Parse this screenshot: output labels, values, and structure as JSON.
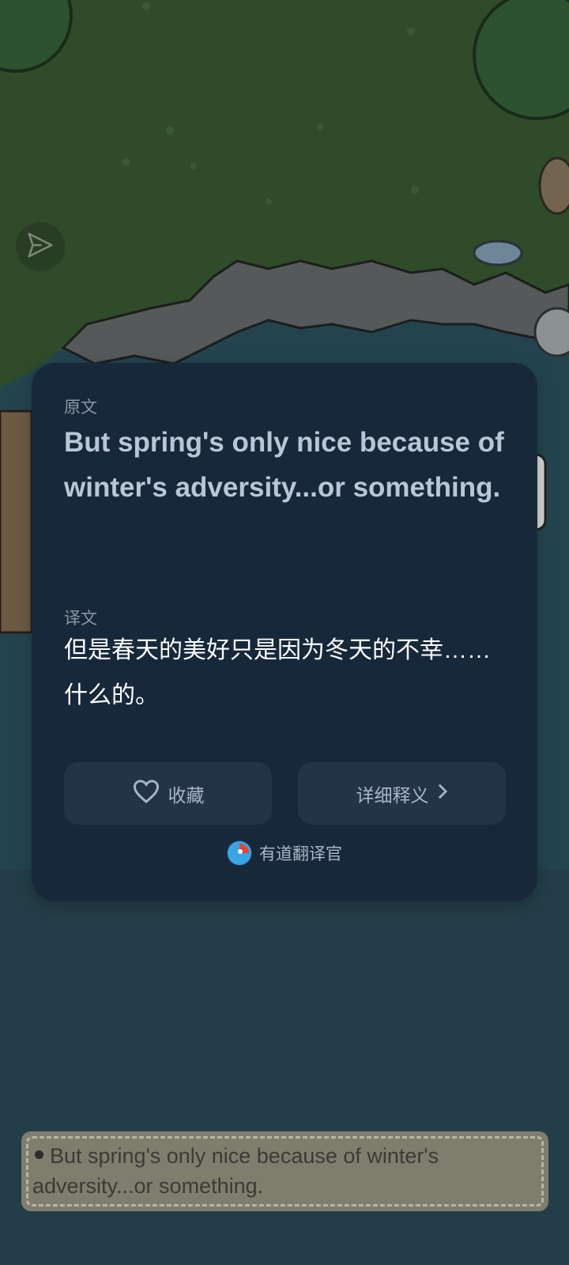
{
  "card": {
    "source_label": "原文",
    "source_text": "But spring's only nice because of winter's adversity...or something.",
    "translation_label": "译文",
    "translation_text": "但是春天的美好只是因为冬天的不幸……什么的。",
    "favorite_label": "收藏",
    "detail_label": "详细释义",
    "brand_name": "有道翻译官"
  },
  "subtitle": {
    "text": "But spring's only nice because of winter's adversity...or something."
  },
  "icons": {
    "share": "send-icon",
    "favorite": "heart-outline-icon",
    "detail": "chevron-right-icon",
    "brand": "youdao-logo-icon"
  },
  "colors": {
    "card_bg": "#18283b",
    "button_bg": "#233449",
    "grass": "#2e4a28",
    "water": "#22454f"
  }
}
